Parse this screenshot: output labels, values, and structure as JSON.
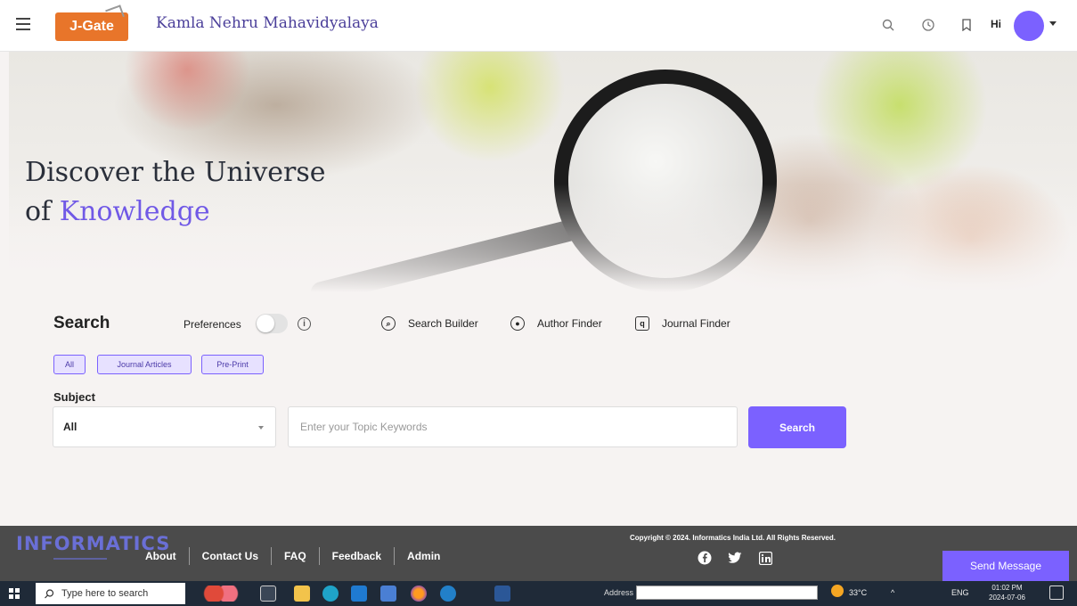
{
  "header": {
    "logo_text": "J-Gate",
    "institution": "Kamla Nehru Mahavidyalaya",
    "greeting": "Hi"
  },
  "hero": {
    "title_line1": "Discover the Universe",
    "title_of": "of ",
    "title_accent": "Knowledge"
  },
  "search": {
    "title": "Search",
    "preferences_label": "Preferences",
    "tools": [
      "Search Builder",
      "Author Finder",
      "Journal Finder"
    ],
    "chips": [
      "All",
      "Journal Articles",
      "Pre-Print"
    ],
    "subject_label": "Subject",
    "subject_value": "All",
    "keyword_placeholder": "Enter your Topic Keywords",
    "button": "Search"
  },
  "footer": {
    "brand": "INFORMATICS",
    "links": [
      "About",
      "Contact Us",
      "FAQ",
      "Feedback",
      "Admin"
    ],
    "copyright": "Copyright © 2024. Informatics India Ltd. All Rights Reserved.",
    "send_message": "Send Message"
  },
  "taskbar": {
    "search_placeholder": "Type here to search",
    "address_label": "Address",
    "temperature": "33°C",
    "language": "ENG",
    "time": "01:02 PM",
    "date": "2024-07-06"
  },
  "colors": {
    "accent": "#7b61ff",
    "institution": "#4b3f9a",
    "footer_bg": "#4b4b4b",
    "logo": "#e8752a"
  }
}
